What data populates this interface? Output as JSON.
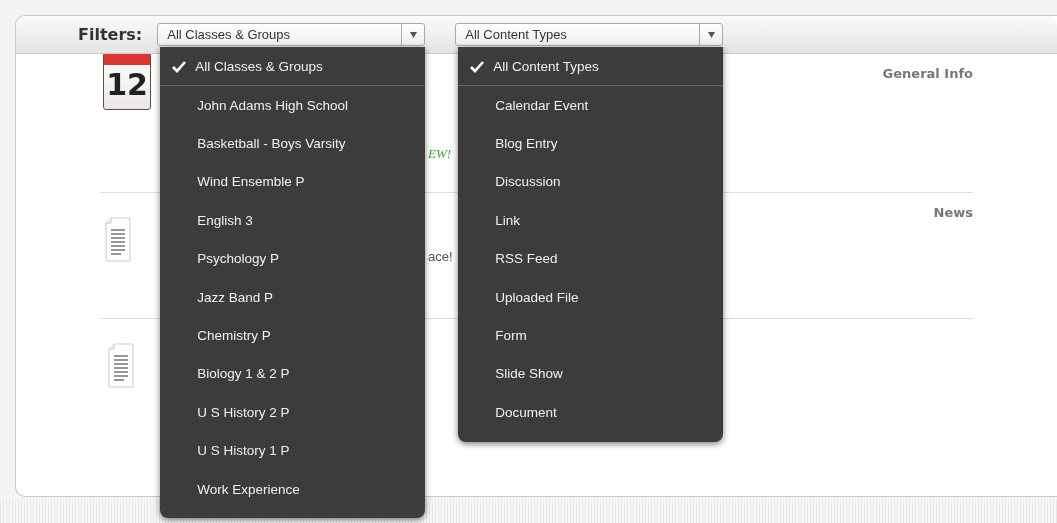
{
  "filters": {
    "label": "Filters:",
    "selects": [
      {
        "value": "All Classes & Groups",
        "expanded": true,
        "options": [
          {
            "label": "All Classes & Groups",
            "selected": true
          },
          {
            "label": "John Adams High School",
            "selected": false
          },
          {
            "label": "Basketball - Boys Varsity",
            "selected": false
          },
          {
            "label": "Wind Ensemble P",
            "selected": false
          },
          {
            "label": "English 3",
            "selected": false
          },
          {
            "label": "Psychology P",
            "selected": false
          },
          {
            "label": "Jazz Band P",
            "selected": false
          },
          {
            "label": "Chemistry P",
            "selected": false
          },
          {
            "label": "Biology 1 & 2 P",
            "selected": false
          },
          {
            "label": "U S History 2 P",
            "selected": false
          },
          {
            "label": "U S History 1 P",
            "selected": false
          },
          {
            "label": "Work Experience",
            "selected": false
          }
        ]
      },
      {
        "value": "All Content Types",
        "expanded": true,
        "options": [
          {
            "label": "All Content Types",
            "selected": true
          },
          {
            "label": "Calendar Event",
            "selected": false
          },
          {
            "label": "Blog Entry",
            "selected": false
          },
          {
            "label": "Discussion",
            "selected": false
          },
          {
            "label": "Link",
            "selected": false
          },
          {
            "label": "RSS Feed",
            "selected": false
          },
          {
            "label": "Uploaded File",
            "selected": false
          },
          {
            "label": "Form",
            "selected": false
          },
          {
            "label": "Slide Show",
            "selected": false
          },
          {
            "label": "Document",
            "selected": false
          }
        ]
      }
    ]
  },
  "items": [
    {
      "kind": "calendar",
      "day": "12",
      "category": "General Info",
      "fragment": {
        "kind": "new",
        "text": "EW!"
      }
    },
    {
      "kind": "document",
      "category": "News",
      "fragment": {
        "kind": "text",
        "text": "ace!"
      }
    },
    {
      "kind": "document"
    }
  ]
}
